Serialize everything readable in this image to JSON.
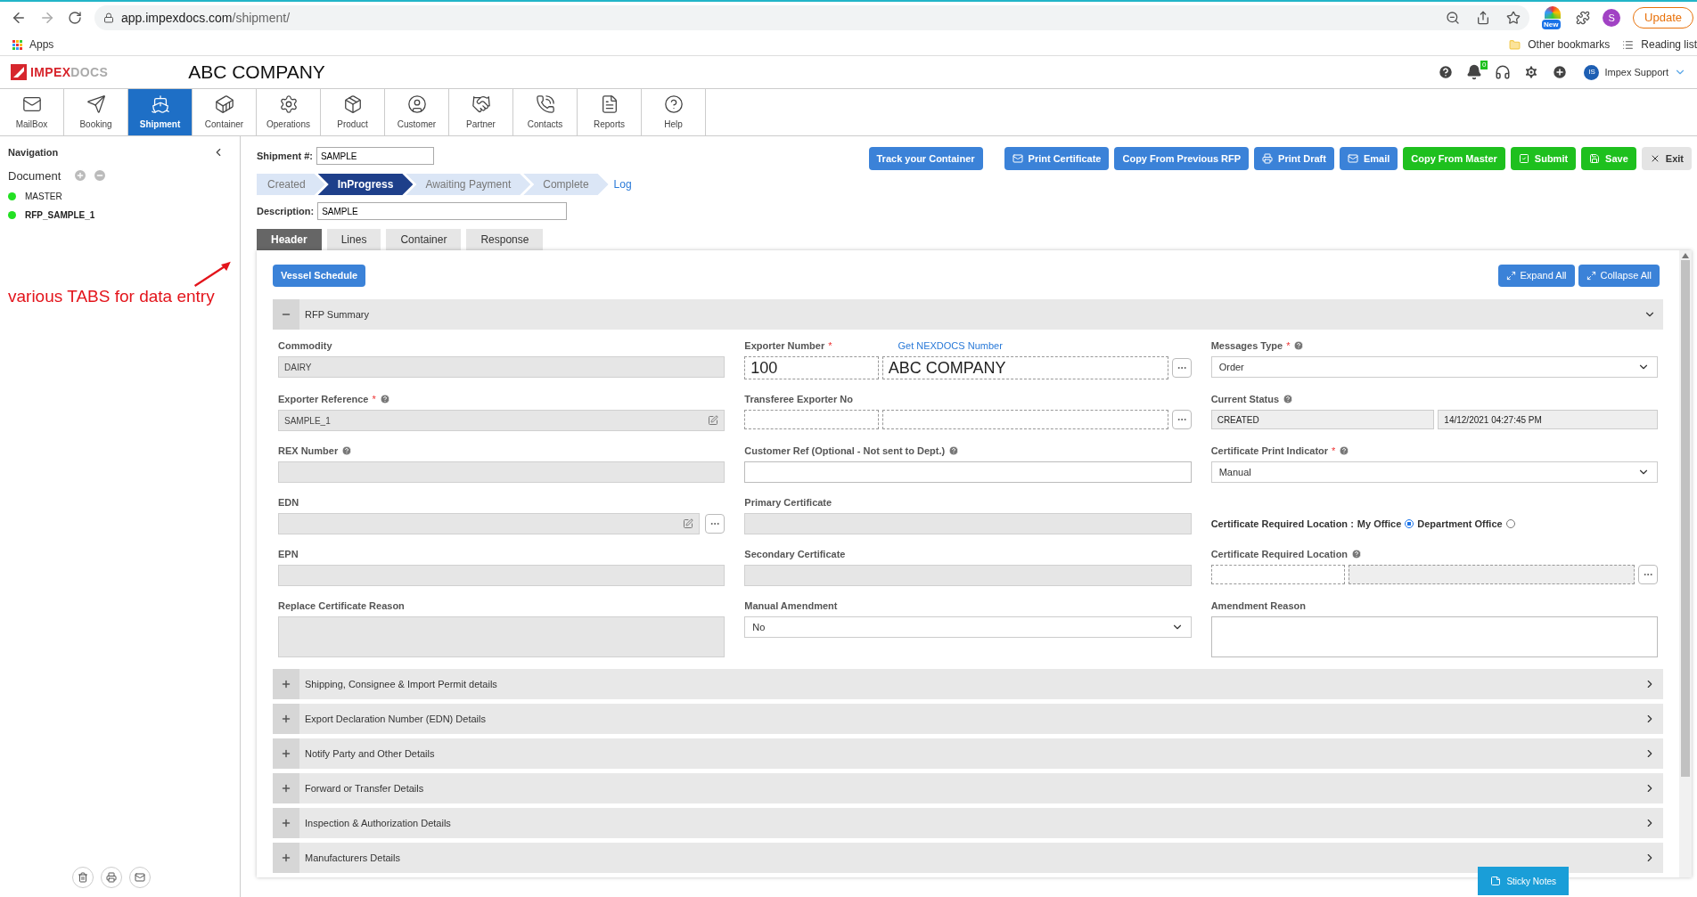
{
  "browser": {
    "url_host": "app.impexdocs.com",
    "url_path": "/shipment/",
    "new_badge": "New",
    "profile": "S",
    "update": "Update",
    "apps": "Apps",
    "other_bookmarks": "Other bookmarks",
    "reading_list": "Reading list"
  },
  "header": {
    "logo": [
      "IMPEX",
      "DOCS"
    ],
    "company": "ABC COMPANY",
    "notifications": "0",
    "avatar": "IS",
    "user": "Impex Support"
  },
  "modules": [
    {
      "label": "MailBox",
      "selected": false
    },
    {
      "label": "Booking",
      "selected": false
    },
    {
      "label": "Shipment",
      "selected": true
    },
    {
      "label": "Container",
      "selected": false
    },
    {
      "label": "Operations",
      "selected": false
    },
    {
      "label": "Product",
      "selected": false
    },
    {
      "label": "Customer",
      "selected": false
    },
    {
      "label": "Partner",
      "selected": false
    },
    {
      "label": "Contacts",
      "selected": false
    },
    {
      "label": "Reports",
      "selected": false
    },
    {
      "label": "Help",
      "selected": false
    }
  ],
  "sidebar": {
    "title": "Navigation",
    "document_label": "Document",
    "documents": [
      {
        "name": "MASTER",
        "color": "#22e022",
        "selected": false
      },
      {
        "name": "RFP_SAMPLE_1",
        "color": "#22e022",
        "selected": true
      }
    ]
  },
  "annotation": "various TABS for data entry",
  "shipment": {
    "label": "Shipment #:",
    "value": "SAMPLE",
    "description_label": "Description:",
    "description": "SAMPLE",
    "log": "Log"
  },
  "steps": [
    {
      "label": "Created",
      "selected": false
    },
    {
      "label": "InProgress",
      "selected": true
    },
    {
      "label": "Awaiting Payment",
      "selected": false
    },
    {
      "label": "Complete",
      "selected": false
    }
  ],
  "actions": [
    {
      "label": "Track your Container",
      "kind": "primary"
    },
    {
      "label": "Print Certificate",
      "kind": "primary"
    },
    {
      "label": "Copy From Previous RFP",
      "kind": "primary"
    },
    {
      "label": "Print Draft",
      "kind": "primary"
    },
    {
      "label": "Email",
      "kind": "primary"
    },
    {
      "label": "Copy From Master",
      "kind": "success"
    },
    {
      "label": "Submit",
      "kind": "success"
    },
    {
      "label": "Save",
      "kind": "success"
    },
    {
      "label": "Exit",
      "kind": "plain"
    }
  ],
  "tabs": [
    {
      "label": "Header",
      "selected": true
    },
    {
      "label": "Lines",
      "selected": false
    },
    {
      "label": "Container",
      "selected": false
    },
    {
      "label": "Response",
      "selected": false
    }
  ],
  "panel": {
    "vessel_button": "Vessel Schedule",
    "expand_all": "Expand All",
    "collapse_all": "Collapse All",
    "sticky_notes": "Sticky Notes",
    "sections": [
      {
        "title": "RFP Summary",
        "expanded": true,
        "fields": [
          {
            "kind": "input",
            "label": "Commodity",
            "readonly": true,
            "value": "DAIRY"
          },
          {
            "kind": "pair",
            "label": "Exporter Number",
            "asterisk": "*",
            "link": "Get NEXDOCS Number",
            "large": true,
            "dashed": true,
            "more": true,
            "boxes": [
              {
                "value": "100",
                "readonly": false
              },
              {
                "value": "ABC COMPANY",
                "readonly": false
              }
            ]
          },
          {
            "kind": "select",
            "label": "Messages Type",
            "asterisk": "*",
            "help": true,
            "value": "Order"
          },
          {
            "kind": "input",
            "label": "Exporter Reference",
            "asterisk": "*",
            "help": true,
            "readonly": true,
            "value": "SAMPLE_1",
            "editable": true
          },
          {
            "kind": "pair",
            "label": "Transferee Exporter No",
            "dashed": true,
            "more": true,
            "boxes": [
              {
                "readonly": false
              },
              {
                "readonly": false
              }
            ]
          },
          {
            "kind": "pair",
            "label": "Current Status",
            "help": true,
            "boxes": [
              {
                "value": "CREATED",
                "readonly": true
              },
              {
                "value": "14/12/2021 04:27:45 PM",
                "readonly": true
              }
            ]
          },
          {
            "kind": "input",
            "label": "REX Number",
            "help": true,
            "readonly": true
          },
          {
            "kind": "input",
            "label": "Customer Ref (Optional - Not sent to Dept.)",
            "help": true,
            "readonly": false
          },
          {
            "kind": "select",
            "label": "Certificate Print Indicator",
            "asterisk": "*",
            "help": true,
            "value": "Manual"
          },
          {
            "kind": "input",
            "label": "EDN",
            "readonly": true,
            "editable": true,
            "more": true
          },
          {
            "kind": "input",
            "label": "Primary Certificate",
            "readonly": true
          },
          {
            "kind": "radio",
            "label": "Certificate Required Location :",
            "options": [
              {
                "label": "My Office",
                "selected": true
              },
              {
                "label": "Department Office",
                "selected": false
              }
            ]
          },
          {
            "kind": "input",
            "label": "EPN",
            "readonly": true
          },
          {
            "kind": "input",
            "label": "Secondary Certificate",
            "readonly": true
          },
          {
            "kind": "pair",
            "label": "Certificate Required Location",
            "help": true,
            "dashed": true,
            "more": true,
            "boxes": [
              {
                "readonly": false
              },
              {
                "readonly": true
              }
            ]
          },
          {
            "kind": "textarea",
            "label": "Replace Certificate Reason",
            "readonly": true
          },
          {
            "kind": "select",
            "label": "Manual Amendment",
            "value": "No"
          },
          {
            "kind": "textarea",
            "label": "Amendment Reason",
            "readonly": false
          }
        ]
      },
      {
        "title": "Shipping, Consignee & Import Permit details",
        "expanded": false
      },
      {
        "title": "Export Declaration Number (EDN) Details",
        "expanded": false
      },
      {
        "title": "Notify Party and Other Details",
        "expanded": false
      },
      {
        "title": "Forward or Transfer Details",
        "expanded": false
      },
      {
        "title": "Inspection & Authorization Details",
        "expanded": false
      },
      {
        "title": "Manufacturers Details",
        "expanded": false
      }
    ]
  }
}
